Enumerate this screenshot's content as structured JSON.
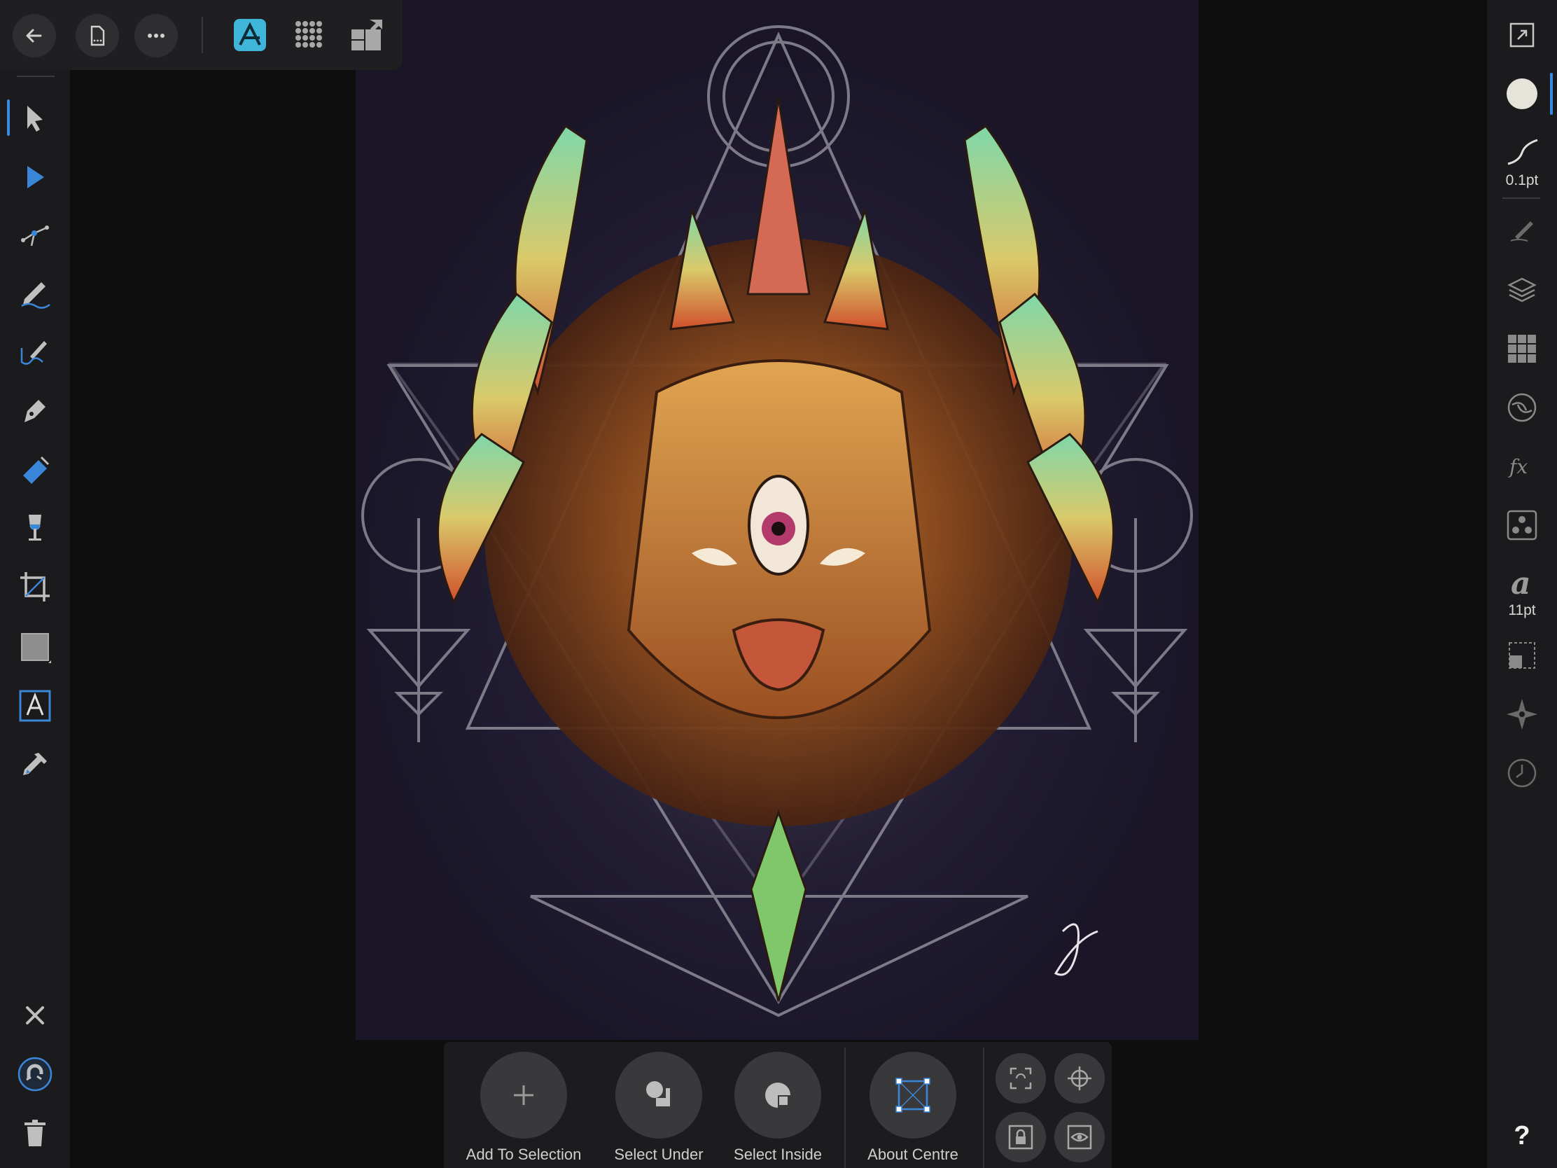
{
  "top_toolbar": {
    "back_icon": "back-arrow-icon",
    "document_icon": "document-icon",
    "more_icon": "more-icon",
    "personas": [
      "designer-persona-icon",
      "pixel-persona-icon",
      "export-persona-icon"
    ]
  },
  "left_toolbar": {
    "tools": [
      "move-tool-icon",
      "node-tool-icon",
      "corner-tool-icon",
      "pencil-tool-icon",
      "vector-brush-tool-icon",
      "pen-tool-icon",
      "fill-tool-icon",
      "transparency-tool-icon",
      "crop-tool-icon",
      "rectangle-tool-icon",
      "text-tool-icon",
      "color-picker-tool-icon"
    ],
    "active_tool": "move-tool-icon",
    "bottom": [
      "close-icon",
      "snapping-icon",
      "delete-icon"
    ]
  },
  "right_toolbar": {
    "fill_color": "#e6e3da",
    "stroke_width_label": "0.1pt",
    "font_size_label": "11pt",
    "panels": [
      "brushes-icon",
      "layers-icon",
      "swatches-icon",
      "color-icon",
      "fx-icon",
      "styles-icon",
      "text-style-icon",
      "transform-icon",
      "navigator-icon",
      "history-icon"
    ],
    "help_label": "?"
  },
  "context_toolbar": {
    "items": [
      {
        "label": "Add To Selection",
        "icon": "plus-icon"
      },
      {
        "label": "Select Under",
        "icon": "select-under-icon"
      },
      {
        "label": "Select Inside",
        "icon": "select-inside-icon"
      },
      {
        "label": "About Centre",
        "icon": "about-centre-icon"
      }
    ],
    "small_buttons": [
      "transform-origin-icon",
      "crosshair-icon",
      "lock-icon",
      "visibility-icon"
    ]
  },
  "canvas": {
    "background": "#1a1628",
    "signature": "Jungle"
  }
}
